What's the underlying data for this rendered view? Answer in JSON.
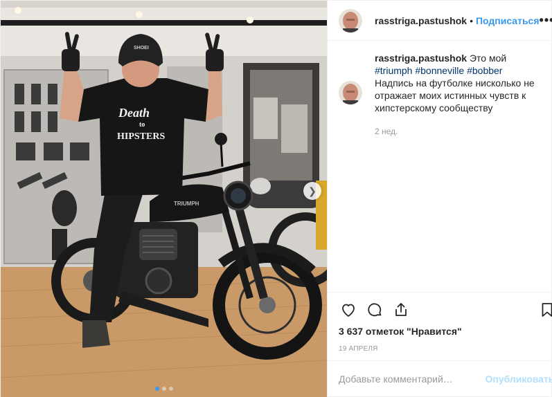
{
  "post": {
    "author": "rasstriga.pastushok",
    "separator": "•",
    "follow_label": "Подписаться",
    "more_label": "•••",
    "caption": {
      "username": "rasstriga.pastushok",
      "text_intro": "Это мой",
      "hashtags": [
        "#triumph",
        "#bonneville",
        "#bobber"
      ],
      "line1": "Надпись на футболке нисколько не",
      "line2": "отражает моих истинных чувств к",
      "line3": "хипстерскому сообществу",
      "time_ago": "2 нед."
    },
    "likes_text": "3 637 отметок \"Нравится\"",
    "date_text": "19 АПРЕЛЯ",
    "comment_placeholder": "Добавьте комментарий…",
    "publish_label": "Опубликовать",
    "carousel": {
      "total": 3,
      "current": 1
    },
    "photo": {
      "shirt_text_line1": "Death",
      "shirt_text_line2": "to",
      "shirt_text_line3": "HIPSTERS",
      "helmet_brand": "SHOEI",
      "tank_brand": "TRIUMPH"
    },
    "icons": {
      "like": "heart-icon",
      "comment": "comment-icon",
      "share": "share-icon",
      "save": "bookmark-icon",
      "next": "chevron-right-icon"
    },
    "colors": {
      "accent": "#3897f0",
      "hashtag": "#003569",
      "muted": "#999999",
      "publish_disabled": "#b2dffc"
    }
  }
}
